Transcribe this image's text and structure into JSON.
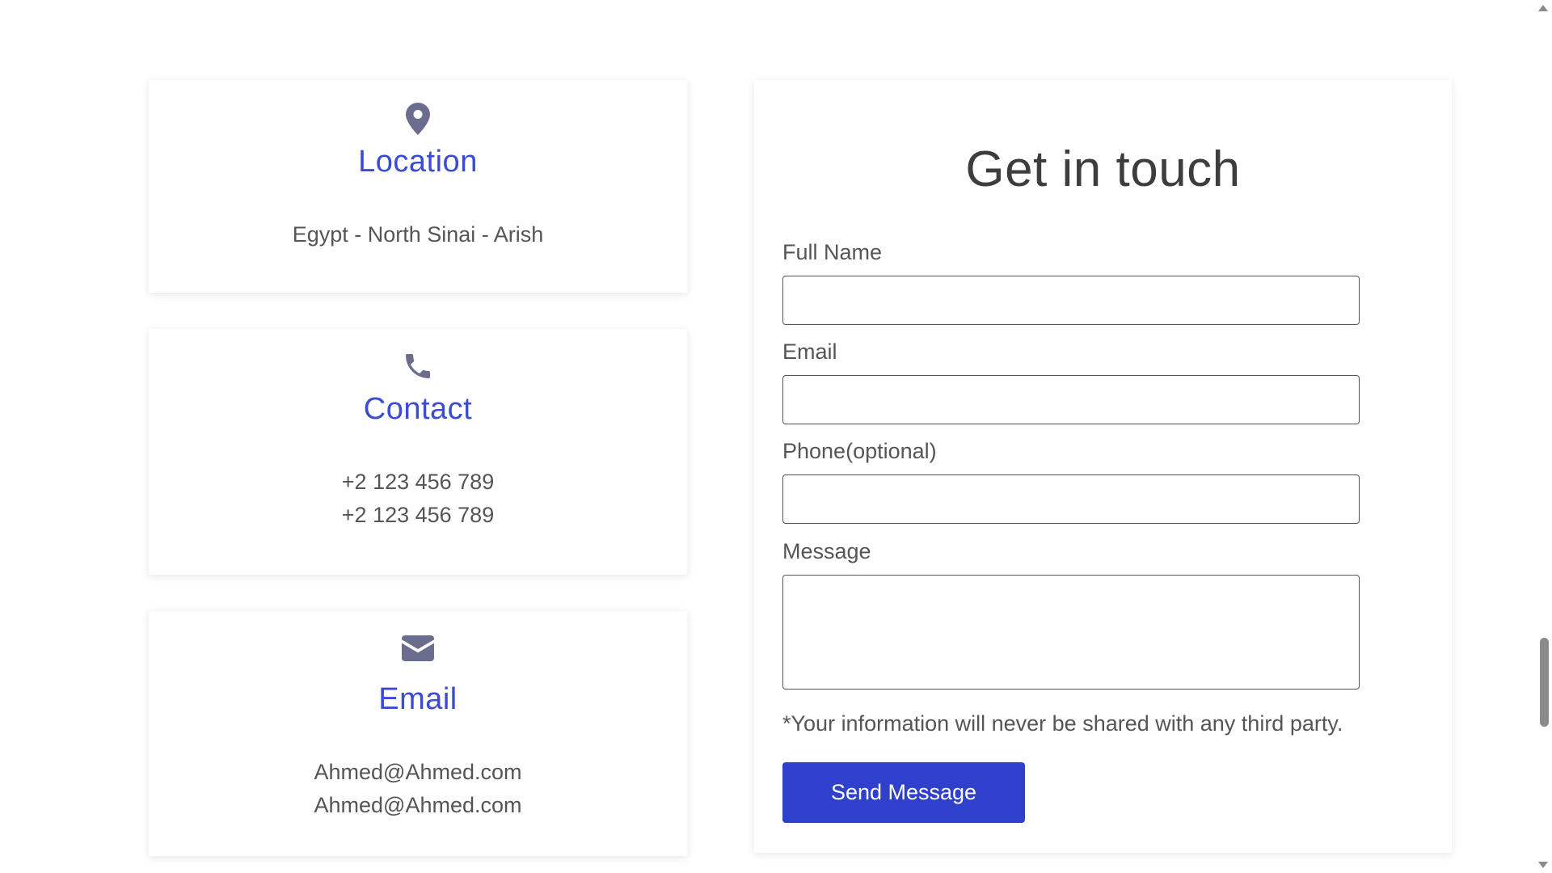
{
  "cards": {
    "location": {
      "icon": "map-pin-icon",
      "title": "Location",
      "lines": [
        "Egypt - North Sinai - Arish"
      ]
    },
    "contact": {
      "icon": "phone-icon",
      "title": "Contact",
      "lines": [
        "+2 123 456 789",
        "+2 123 456 789"
      ]
    },
    "email": {
      "icon": "envelope-icon",
      "title": "Email",
      "lines": [
        "Ahmed@Ahmed.com",
        "Ahmed@Ahmed.com"
      ]
    }
  },
  "form": {
    "title": "Get in touch",
    "fields": {
      "full_name": {
        "label": "Full Name",
        "value": "",
        "placeholder": ""
      },
      "email": {
        "label": "Email",
        "value": "",
        "placeholder": ""
      },
      "phone": {
        "label": "Phone(optional)",
        "value": "",
        "placeholder": ""
      },
      "message": {
        "label": "Message",
        "value": "",
        "placeholder": ""
      }
    },
    "disclaimer": "*Your information will never be shared with any third party.",
    "submit_label": "Send Message"
  },
  "colors": {
    "accent": "#3b4bd3",
    "button": "#2f41cc",
    "icon": "#6b6d8f",
    "text": "#555555"
  }
}
